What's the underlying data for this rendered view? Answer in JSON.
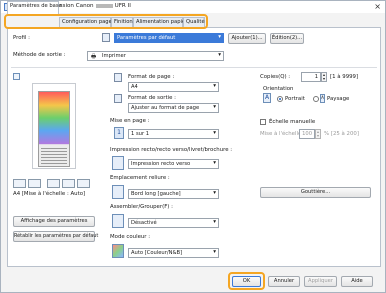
{
  "window": {
    "title_prefix": "Options d'impression Canon",
    "title_suffix": "UFR II",
    "close_glyph": "×"
  },
  "tabs": [
    {
      "label": "Paramètres de base"
    },
    {
      "label": "Configuration page"
    },
    {
      "label": "Finition"
    },
    {
      "label": "Alimentation papier"
    },
    {
      "label": "Qualité"
    }
  ],
  "profile": {
    "label": "Profil :",
    "value": "Paramètres par défaut",
    "add_button": "Ajouter(1)...",
    "edit_button": "Édition(2)..."
  },
  "output": {
    "label": "Méthode de sortie :",
    "value": "Imprimer"
  },
  "preview": {
    "caption": "A4 [Mise à l'échelle : Auto]",
    "show_settings_button": "Affichage des paramètres",
    "restore_defaults_button": "Rétablir les paramètres par défaut"
  },
  "page_format": {
    "label": "Format de page :",
    "value": "A4"
  },
  "output_format": {
    "label": "Format de sortie :",
    "value": "Ajuster au format de page"
  },
  "copies": {
    "label": "Copies(Q) :",
    "value": "1",
    "range": "[1 à 9999]"
  },
  "orientation": {
    "label": "Orientation",
    "portrait": "Portrait",
    "landscape": "Paysage",
    "selected": "portrait"
  },
  "layout": {
    "label": "Mise en page :",
    "value": "1 sur 1"
  },
  "manual_scale": {
    "label": "Échelle manuelle",
    "checked": false,
    "scale_label": "Mise à l'échelle :",
    "scale_value": "100",
    "scale_range": "% [25 à 200]"
  },
  "duplex": {
    "label": "Impression recto/recto verso/livret/brochure :",
    "value": "Impression recto verso"
  },
  "binding": {
    "label": "Emplacement reliure :",
    "value": "Bord long [gauche]",
    "gutter_button": "Gouttière..."
  },
  "collate": {
    "label": "Assembler/Grouper(F) :",
    "value": "Désactivé"
  },
  "color_mode": {
    "label": "Mode couleur :",
    "value": "Auto [Couleur/N&B]"
  },
  "footer": {
    "ok": "OK",
    "cancel": "Annuler",
    "apply": "Appliquer",
    "help": "Aide"
  },
  "colors": {
    "accent": "#f4a623",
    "selection": "#3b7ad9"
  }
}
